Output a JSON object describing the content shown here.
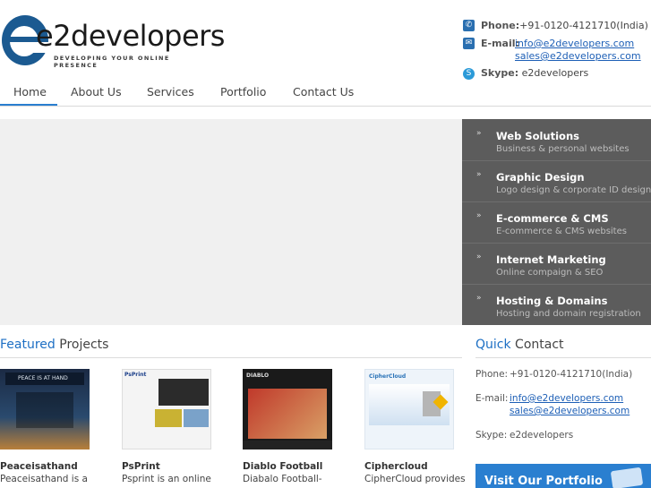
{
  "logo": {
    "wordmark": "e2developers",
    "tagline": "DEVELOPING YOUR ONLINE PRESENCE"
  },
  "header_contact": {
    "phone_label": "Phone:",
    "phone": "+91-0120-4121710(India)",
    "email_label": "E-mail:",
    "email1": "info@e2developers.com",
    "email2": "sales@e2developers.com",
    "skype_label": "Skype:",
    "skype": "e2developers"
  },
  "nav": {
    "items": [
      {
        "label": "Home"
      },
      {
        "label": "About Us"
      },
      {
        "label": "Services"
      },
      {
        "label": "Portfolio"
      },
      {
        "label": "Contact Us"
      }
    ],
    "active": "Home"
  },
  "services": [
    {
      "title": "Web Solutions",
      "subtitle": "Business & personal websites"
    },
    {
      "title": "Graphic Design",
      "subtitle": "Logo design & corporate ID design"
    },
    {
      "title": "E-commerce & CMS",
      "subtitle": "E-commerce & CMS websites"
    },
    {
      "title": "Internet Marketing",
      "subtitle": "Online compaign & SEO"
    },
    {
      "title": "Hosting & Domains",
      "subtitle": "Hosting and domain registration"
    }
  ],
  "featured": {
    "title_hl": "Featured",
    "title_rest": " Projects",
    "projects": [
      {
        "name": "Peaceisathand",
        "desc": "Peaceisathand is a",
        "thumb_text": "PEACE IS AT HAND"
      },
      {
        "name": "PsPrint",
        "desc": "Psprint is an online",
        "thumb_text": "PsPrint"
      },
      {
        "name": "Diablo Football",
        "desc": "Diabalo Football-",
        "thumb_text": "DIABLO"
      },
      {
        "name": "Ciphercloud",
        "desc": "CipherCloud provides",
        "thumb_text": "CipherCloud"
      }
    ]
  },
  "quick_contact": {
    "title_hl": "Quick",
    "title_rest": " Contact",
    "phone_label": "Phone:",
    "phone": "+91-0120-4121710(India)",
    "email_label": "E-mail:",
    "email1": "info@e2developers.com",
    "email2": "sales@e2developers.com",
    "skype_label": "Skype:",
    "skype": "e2developers"
  },
  "portfolio_button": {
    "label": "Visit Our Portfolio"
  },
  "colors": {
    "accent": "#2a7fd0",
    "services_bg": "#5c5c5c",
    "link": "#1d5fb6",
    "logo_blue": "#1b5a91"
  }
}
